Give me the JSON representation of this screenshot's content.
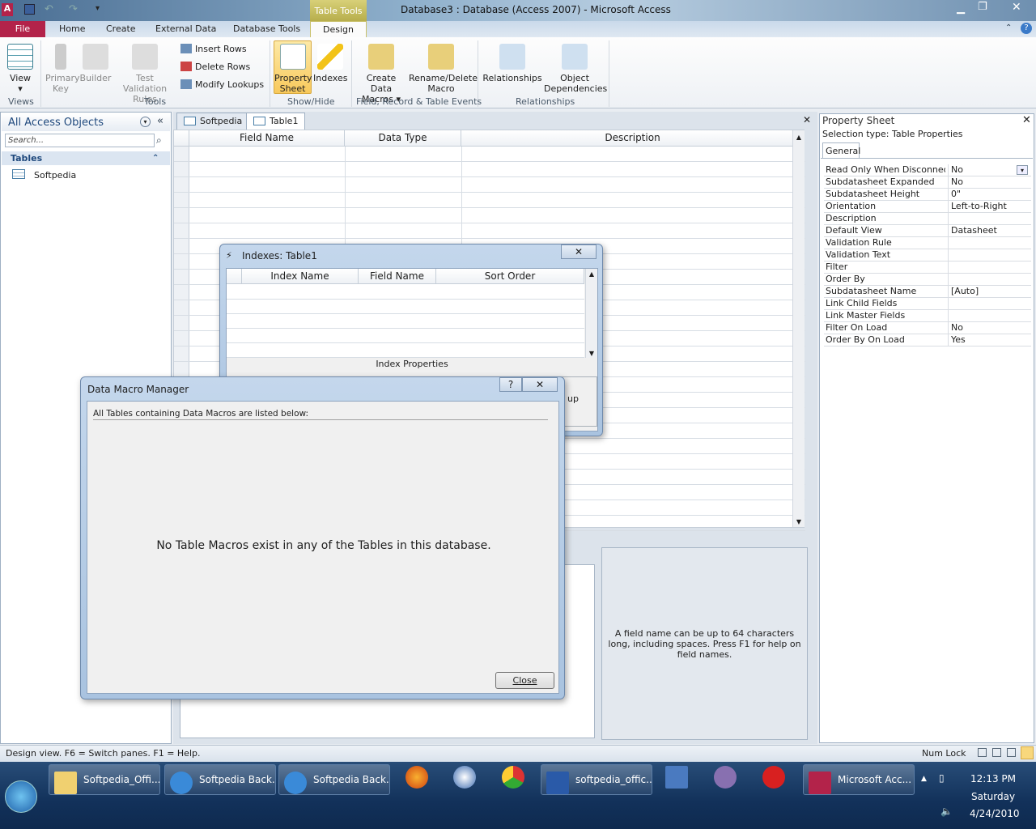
{
  "window": {
    "title": "Database3 : Database (Access 2007)  -  Microsoft Access",
    "contextual_tab": "Table Tools"
  },
  "ribbon_tabs": [
    "File",
    "Home",
    "Create",
    "External Data",
    "Database Tools",
    "Design"
  ],
  "ribbon": {
    "view": "View",
    "primary_key": [
      "Primary",
      "Key"
    ],
    "builder": "Builder",
    "test_validation": [
      "Test Validation",
      "Rules"
    ],
    "insert_rows": "Insert Rows",
    "delete_rows": "Delete Rows",
    "modify_lookups": "Modify Lookups",
    "property_sheet": [
      "Property",
      "Sheet"
    ],
    "indexes": "Indexes",
    "create_data_macros": [
      "Create Data",
      "Macros ▾"
    ],
    "rename_delete_macro": [
      "Rename/Delete",
      "Macro"
    ],
    "relationships": "Relationships",
    "object_dependencies": [
      "Object",
      "Dependencies"
    ],
    "groups": [
      "Views",
      "Tools",
      "Show/Hide",
      "Field, Record & Table Events",
      "Relationships"
    ]
  },
  "nav": {
    "title": "All Access Objects",
    "search_placeholder": "Search...",
    "section": "Tables",
    "items": [
      "Softpedia"
    ]
  },
  "doc_tabs": [
    "Softpedia",
    "Table1"
  ],
  "grid": {
    "columns": [
      "Field Name",
      "Data Type",
      "Description"
    ]
  },
  "help_text": "A field name can be up to 64 characters long, including spaces. Press F1 for help on field names.",
  "property_sheet": {
    "title": "Property Sheet",
    "selection_type": "Selection type:  Table Properties",
    "tab": "General",
    "rows": [
      [
        "Read Only When Disconnected",
        "No"
      ],
      [
        "Subdatasheet Expanded",
        "No"
      ],
      [
        "Subdatasheet Height",
        "0\""
      ],
      [
        "Orientation",
        "Left-to-Right"
      ],
      [
        "Description",
        ""
      ],
      [
        "Default View",
        "Datasheet"
      ],
      [
        "Validation Rule",
        ""
      ],
      [
        "Validation Text",
        ""
      ],
      [
        "Filter",
        ""
      ],
      [
        "Order By",
        ""
      ],
      [
        "Subdatasheet Name",
        "[Auto]"
      ],
      [
        "Link Child Fields",
        ""
      ],
      [
        "Link Master Fields",
        ""
      ],
      [
        "Filter On Load",
        "No"
      ],
      [
        "Order By On Load",
        "Yes"
      ]
    ]
  },
  "indexes_dialog": {
    "title": "Indexes: Table1",
    "columns": [
      "Index Name",
      "Field Name",
      "Sort Order"
    ],
    "section": "Index Properties",
    "partial_text": "up"
  },
  "macro_dialog": {
    "title": "Data Macro Manager",
    "help": "?",
    "intro": "All Tables containing Data Macros are listed below:",
    "message": "No Table Macros exist in any of the Tables in this database.",
    "close": "Close"
  },
  "status": {
    "left": "Design view.  F6 = Switch panes.  F1 = Help.",
    "num_lock": "Num Lock"
  },
  "taskbar": {
    "buttons": [
      "Softpedia_Offi...",
      "Softpedia Back...",
      "Softpedia Back...",
      "softpedia_offic...",
      "Microsoft Acc..."
    ],
    "time": "12:13 PM",
    "day": "Saturday",
    "date": "4/24/2010"
  }
}
